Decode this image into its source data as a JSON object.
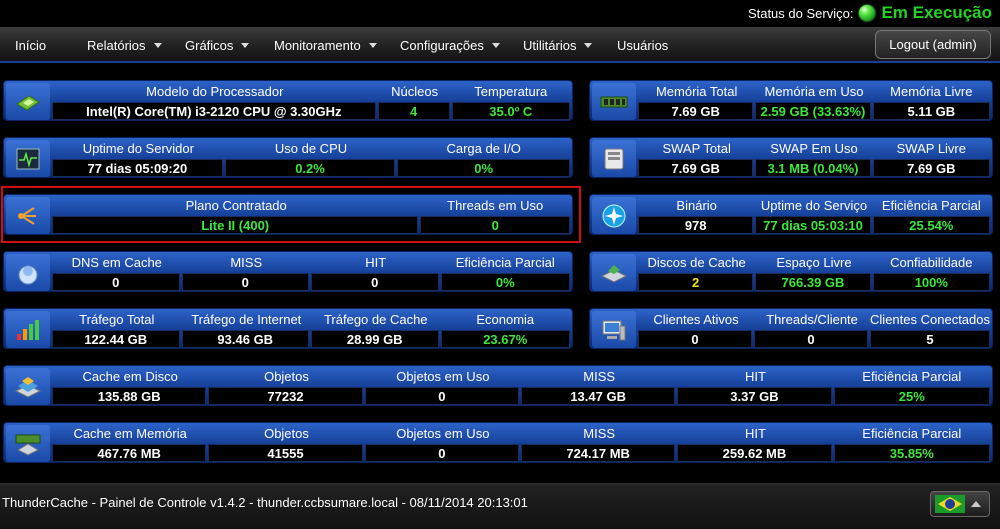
{
  "status": {
    "label": "Status do Serviço:",
    "value": "Em Execução",
    "led_color": "#22d322"
  },
  "nav": {
    "items": [
      {
        "label": "Início",
        "has_dropdown": false
      },
      {
        "label": "Relatórios",
        "has_dropdown": true
      },
      {
        "label": "Gráficos",
        "has_dropdown": true
      },
      {
        "label": "Monitoramento",
        "has_dropdown": true
      },
      {
        "label": "Configurações",
        "has_dropdown": true
      },
      {
        "label": "Utilitários",
        "has_dropdown": true
      },
      {
        "label": "Usuários",
        "has_dropdown": false
      }
    ],
    "logout_label": "Logout (admin)"
  },
  "panels": {
    "cpu": {
      "icon": "processor-chip-icon",
      "cells": [
        {
          "header": "Modelo do Processador",
          "value": "Intel(R) Core(TM) i3-2120 CPU @ 3.30GHz"
        },
        {
          "header": "Núcleos",
          "value": "4",
          "color": "green"
        },
        {
          "header": "Temperatura",
          "value": "35.0º C",
          "color": "green"
        }
      ]
    },
    "memory": {
      "icon": "memory-module-icon",
      "cells": [
        {
          "header": "Memória Total",
          "value": "7.69 GB"
        },
        {
          "header": "Memória em Uso",
          "value": "2.59 GB (33.63%)",
          "color": "green"
        },
        {
          "header": "Memória Livre",
          "value": "5.11 GB"
        }
      ]
    },
    "uptime": {
      "icon": "pulse-monitor-icon",
      "cells": [
        {
          "header": "Uptime do Servidor",
          "value": "77 dias 05:09:20"
        },
        {
          "header": "Uso de CPU",
          "value": "0.2%",
          "color": "green"
        },
        {
          "header": "Carga de I/O",
          "value": "0%",
          "color": "green"
        }
      ]
    },
    "swap": {
      "icon": "hard-drive-icon",
      "cells": [
        {
          "header": "SWAP Total",
          "value": "7.69 GB"
        },
        {
          "header": "SWAP Em Uso",
          "value": "3.1 MB (0.04%)",
          "color": "green"
        },
        {
          "header": "SWAP Livre",
          "value": "7.69 GB"
        }
      ]
    },
    "plan": {
      "icon": "share-network-icon",
      "cells": [
        {
          "header": "Plano Contratado",
          "value": "Lite II (400)",
          "color": "green"
        },
        {
          "header": "Threads em Uso",
          "value": "0",
          "color": "green"
        }
      ]
    },
    "binary": {
      "icon": "sparkle-orb-icon",
      "cells": [
        {
          "header": "Binário",
          "value": "978"
        },
        {
          "header": "Uptime do Serviço",
          "value": "77 dias 05:03:10",
          "color": "green"
        },
        {
          "header": "Eficiência Parcial",
          "value": "25.54%",
          "color": "green"
        }
      ]
    },
    "dns": {
      "icon": "dns-cache-icon",
      "cells": [
        {
          "header": "DNS em Cache",
          "value": "0"
        },
        {
          "header": "MISS",
          "value": "0"
        },
        {
          "header": "HIT",
          "value": "0"
        },
        {
          "header": "Eficiência Parcial",
          "value": "0%",
          "color": "green"
        }
      ]
    },
    "disks": {
      "icon": "disk-cache-icon",
      "cells": [
        {
          "header": "Discos de Cache",
          "value": "2",
          "color": "yellow"
        },
        {
          "header": "Espaço Livre",
          "value": "766.39 GB",
          "color": "green"
        },
        {
          "header": "Confiabilidade",
          "value": "100%",
          "color": "green"
        }
      ]
    },
    "traffic": {
      "icon": "bar-chart-icon",
      "cells": [
        {
          "header": "Tráfego Total",
          "value": "122.44 GB"
        },
        {
          "header": "Tráfego de Internet",
          "value": "93.46 GB"
        },
        {
          "header": "Tráfego de Cache",
          "value": "28.99 GB"
        },
        {
          "header": "Economia",
          "value": "23.67%",
          "color": "green"
        }
      ]
    },
    "clients": {
      "icon": "client-computer-icon",
      "cells": [
        {
          "header": "Clientes Ativos",
          "value": "0"
        },
        {
          "header": "Threads/Cliente",
          "value": "0"
        },
        {
          "header": "Clientes Conectados",
          "value": "5"
        }
      ]
    },
    "disk_cache": {
      "icon": "disk-stack-icon",
      "cells": [
        {
          "header": "Cache em Disco",
          "value": "135.88 GB"
        },
        {
          "header": "Objetos",
          "value": "77232"
        },
        {
          "header": "Objetos em Uso",
          "value": "0"
        },
        {
          "header": "MISS",
          "value": "13.47 GB"
        },
        {
          "header": "HIT",
          "value": "3.37 GB"
        },
        {
          "header": "Eficiência Parcial",
          "value": "25%",
          "color": "green"
        }
      ]
    },
    "mem_cache": {
      "icon": "memory-cache-icon",
      "cells": [
        {
          "header": "Cache em Memória",
          "value": "467.76 MB"
        },
        {
          "header": "Objetos",
          "value": "41555"
        },
        {
          "header": "Objetos em Uso",
          "value": "0"
        },
        {
          "header": "MISS",
          "value": "724.17 MB"
        },
        {
          "header": "HIT",
          "value": "259.62 MB"
        },
        {
          "header": "Eficiência Parcial",
          "value": "35.85%",
          "color": "green"
        }
      ]
    }
  },
  "footer": {
    "text": "ThunderCache - Painel de Controle v1.4.2 - thunder.ccbsumare.local - 08/11/2014 20:13:01",
    "language_icon": "brazil-flag-icon"
  }
}
